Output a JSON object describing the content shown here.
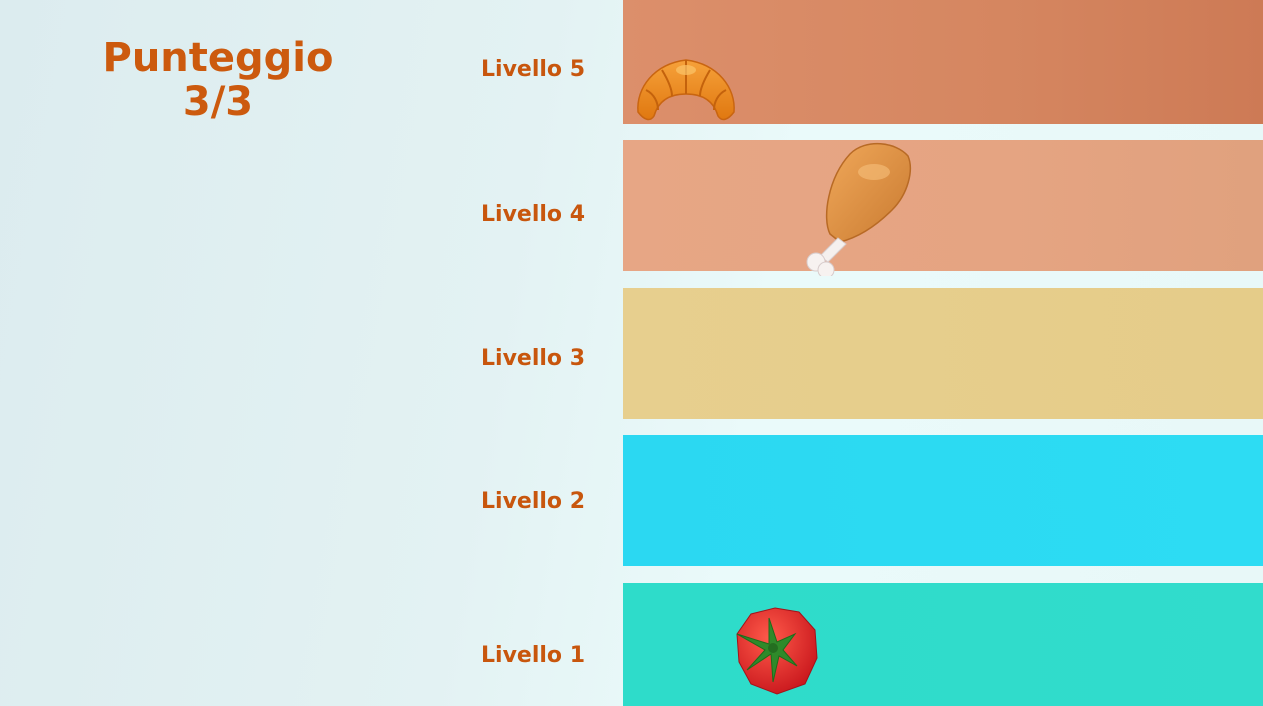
{
  "score": {
    "title": "Punteggio",
    "value": "3/3"
  },
  "levels": [
    {
      "label": "Livello 5",
      "color": "#d58660"
    },
    {
      "label": "Livello 4",
      "color": "#e5a482"
    },
    {
      "label": "Livello 3",
      "color": "#e5cc89"
    },
    {
      "label": "Livello 2",
      "color": "#2bd8f2"
    },
    {
      "label": "Livello 1",
      "color": "#2edcca"
    }
  ],
  "foods": [
    {
      "name": "croissant-icon",
      "level": "Livello 5"
    },
    {
      "name": "chicken-drumstick-icon",
      "level": "Livello 4"
    },
    {
      "name": "tomato-icon",
      "level": "Livello 1"
    }
  ],
  "colors": {
    "text_accent": "#cc5a0e",
    "background": "#e3f2f3"
  }
}
